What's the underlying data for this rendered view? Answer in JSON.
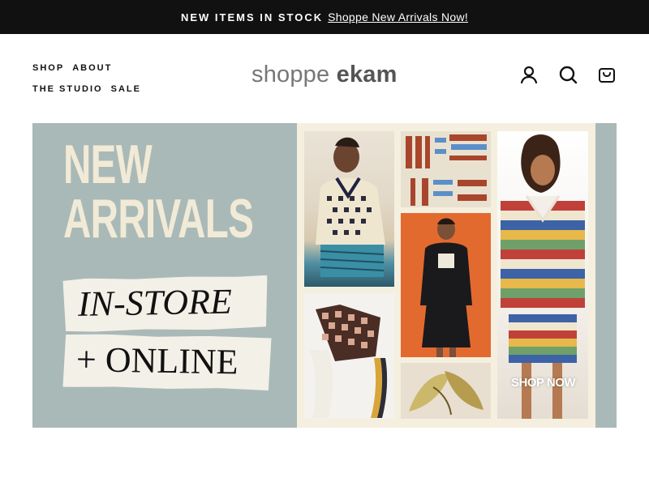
{
  "announcement": {
    "lead": "NEW ITEMS IN STOCK",
    "link": "Shoppe New Arrivals Now!"
  },
  "nav": {
    "items": [
      {
        "label": "SHOP"
      },
      {
        "label": "ABOUT"
      },
      {
        "label": "THE STUDIO"
      },
      {
        "label": "SALE"
      }
    ]
  },
  "logo": {
    "word1": "shoppe",
    "word2": "ekam"
  },
  "header_icons": [
    "account-icon",
    "search-icon",
    "cart-icon"
  ],
  "hero": {
    "title": "NEW\nARRIVALS",
    "line1": "IN-STORE",
    "line2": "+ ONLINE",
    "cta": "SHOP NOW"
  },
  "colors": {
    "announcement_bg": "#111111",
    "hero_bg": "#a9b9b7",
    "title_cream": "#f1ead6",
    "collage_bg": "#f5efdf"
  }
}
